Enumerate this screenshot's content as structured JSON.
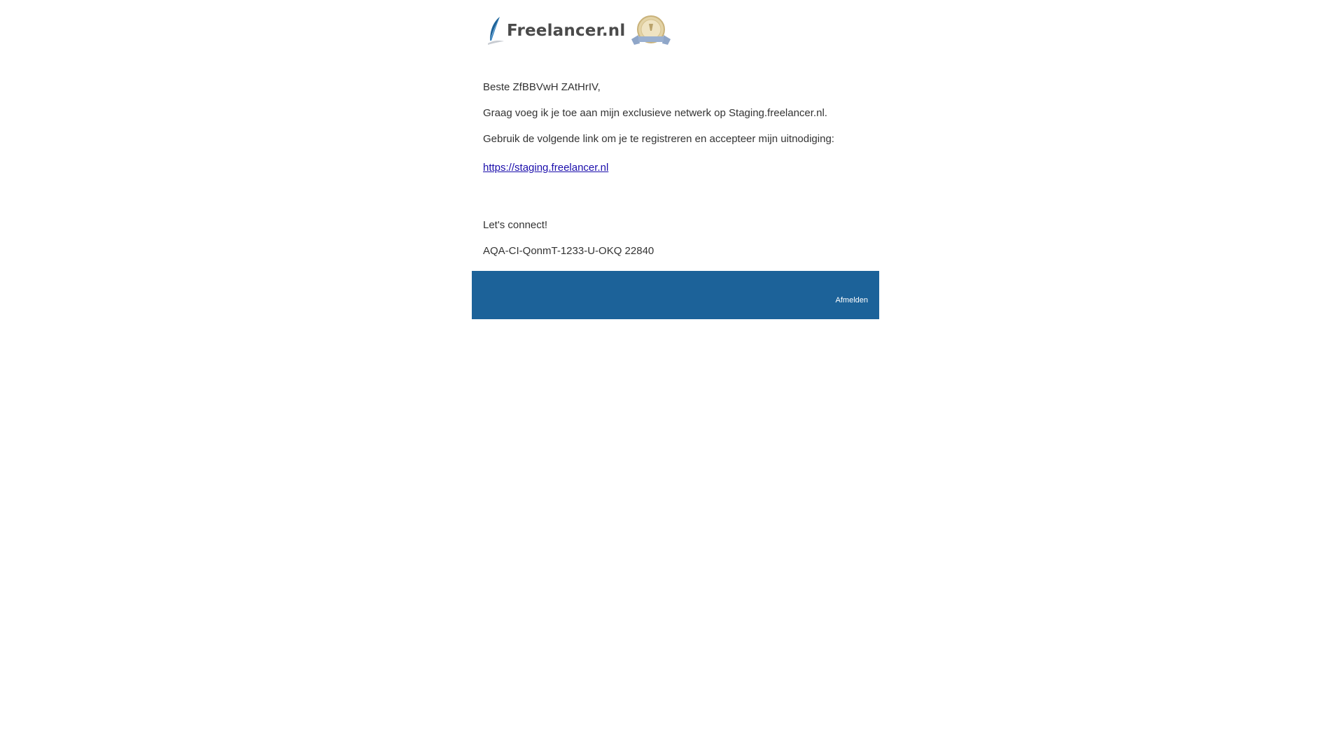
{
  "brand": {
    "name": "Freelancer.nl",
    "quill_color": "#1c6299",
    "award_color": "#c9b27a"
  },
  "message": {
    "greeting": "Beste ZfBBVwH ZAtHrIV,",
    "line1": "Graag voeg ik je toe aan mijn exclusieve netwerk op Staging.freelancer.nl.",
    "line2": "Gebruik de volgende link om je te registreren en accepteer mijn uitnodiging:",
    "link_text": "https://staging.freelancer.nl",
    "closing": "Let's connect!",
    "signature": "AQA-CI-QonmT-1233-U-OKQ 22840"
  },
  "footer": {
    "background": "#1c6299",
    "unsubscribe_label": "Afmelden"
  }
}
